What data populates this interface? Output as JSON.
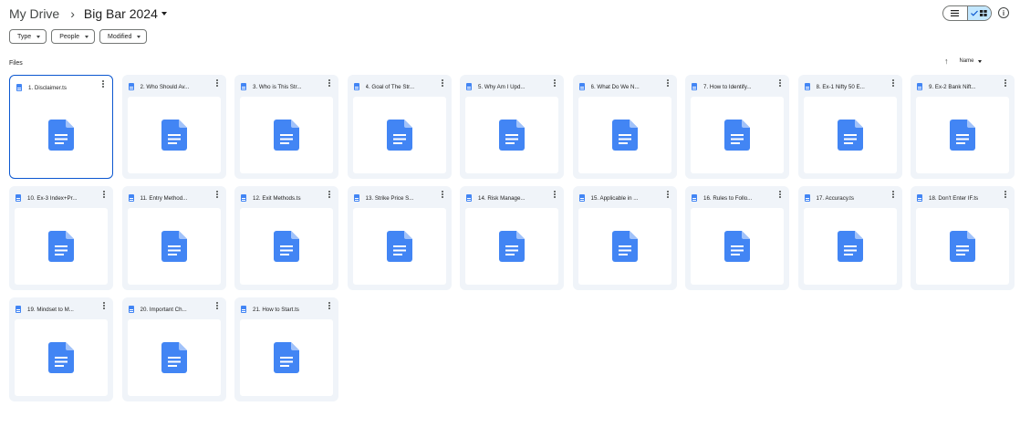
{
  "breadcrumb": {
    "root": "My Drive",
    "separator": "›",
    "current": "Big Bar 2024"
  },
  "view_toggle": {
    "list_icon": "list-icon",
    "grid_icon": "grid-icon",
    "active": "grid"
  },
  "filters": [
    {
      "label": "Type"
    },
    {
      "label": "People"
    },
    {
      "label": "Modified"
    }
  ],
  "section": {
    "label": "Files"
  },
  "sort": {
    "label": "Name"
  },
  "colors": {
    "accent": "#0b57d0",
    "doc_blue": "#4285f4",
    "card_bg": "#f0f4f9",
    "toggle_active": "#c2e7ff"
  },
  "files": [
    {
      "name": "1. Disclaimer.ts"
    },
    {
      "name": "2. Who Should Av..."
    },
    {
      "name": "3. Who is This Str..."
    },
    {
      "name": "4. Goal of The Str..."
    },
    {
      "name": "5. Why Am I Upd..."
    },
    {
      "name": "6. What Do We N..."
    },
    {
      "name": "7. How to Identify..."
    },
    {
      "name": "8. Ex-1 Nifty 50 E..."
    },
    {
      "name": "9. Ex-2 Bank Nift..."
    },
    {
      "name": "10. Ex-3 Index+Pr..."
    },
    {
      "name": "11. Entry Method..."
    },
    {
      "name": "12. Exit Methods.ts"
    },
    {
      "name": "13. Strike Price S..."
    },
    {
      "name": "14. Risk Manage..."
    },
    {
      "name": "15. Applicable in ..."
    },
    {
      "name": "16. Rules to Follo..."
    },
    {
      "name": "17. Accuracy.ts"
    },
    {
      "name": "18. Don't Enter IF.ts"
    },
    {
      "name": "19. Mindset to M..."
    },
    {
      "name": "20. Important Ch..."
    },
    {
      "name": "21. How to Start.ts"
    }
  ]
}
